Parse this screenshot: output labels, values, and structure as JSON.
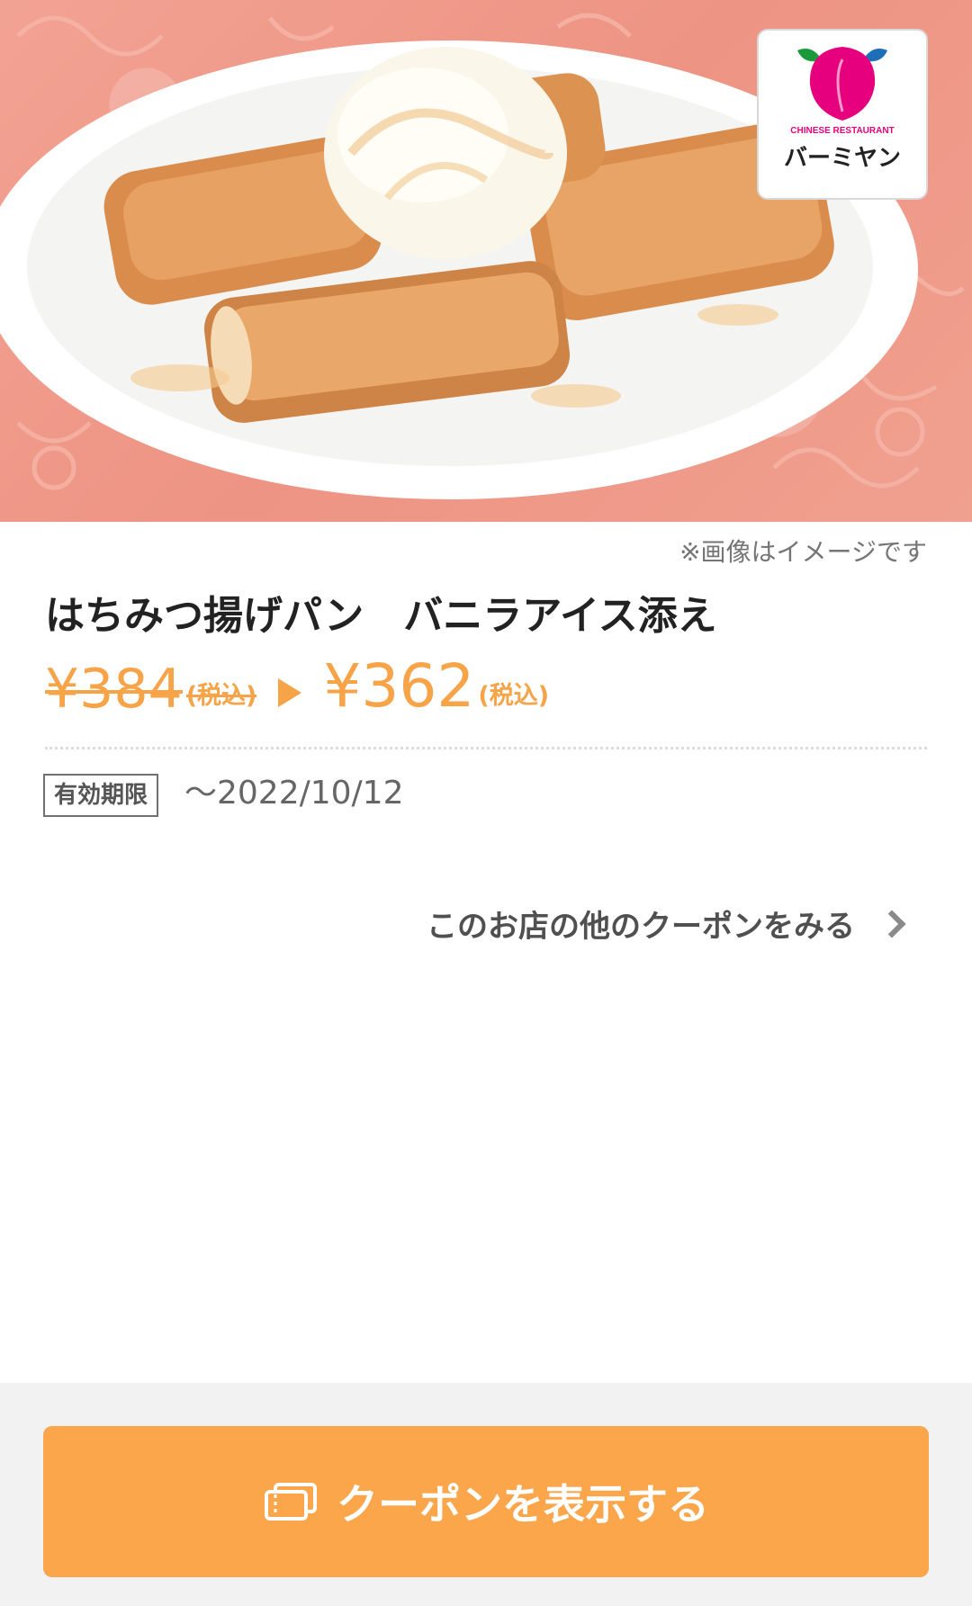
{
  "hero": {
    "image": "honey-fried-bread-with-vanilla-ice-cream-photo",
    "logo": {
      "tagline": "CHINESE RESTAURANT",
      "name": "バーミヤン",
      "icon": "peach-icon"
    }
  },
  "image_note": "※画像はイメージです",
  "product": {
    "title": "はちみつ揚げパン　バニラアイス添え"
  },
  "price": {
    "original": "¥384",
    "original_tax": "(税込)",
    "discounted": "¥362",
    "discounted_tax": "(税込)",
    "arrow_icon": "play-arrow-icon"
  },
  "expiry": {
    "label": "有効期限",
    "value": "〜2022/10/12"
  },
  "links": {
    "other_coupons": "このお店の他のクーポンをみる",
    "chevron_icon": "chevron-right-icon"
  },
  "actions": {
    "show_coupon": "クーポンを表示する",
    "show_coupon_icon": "ticket-icon"
  },
  "colors": {
    "accent": "#f7a347",
    "button": "#fba64b",
    "hero_background": "#ee9484",
    "logo_peach": "#e6007e"
  }
}
